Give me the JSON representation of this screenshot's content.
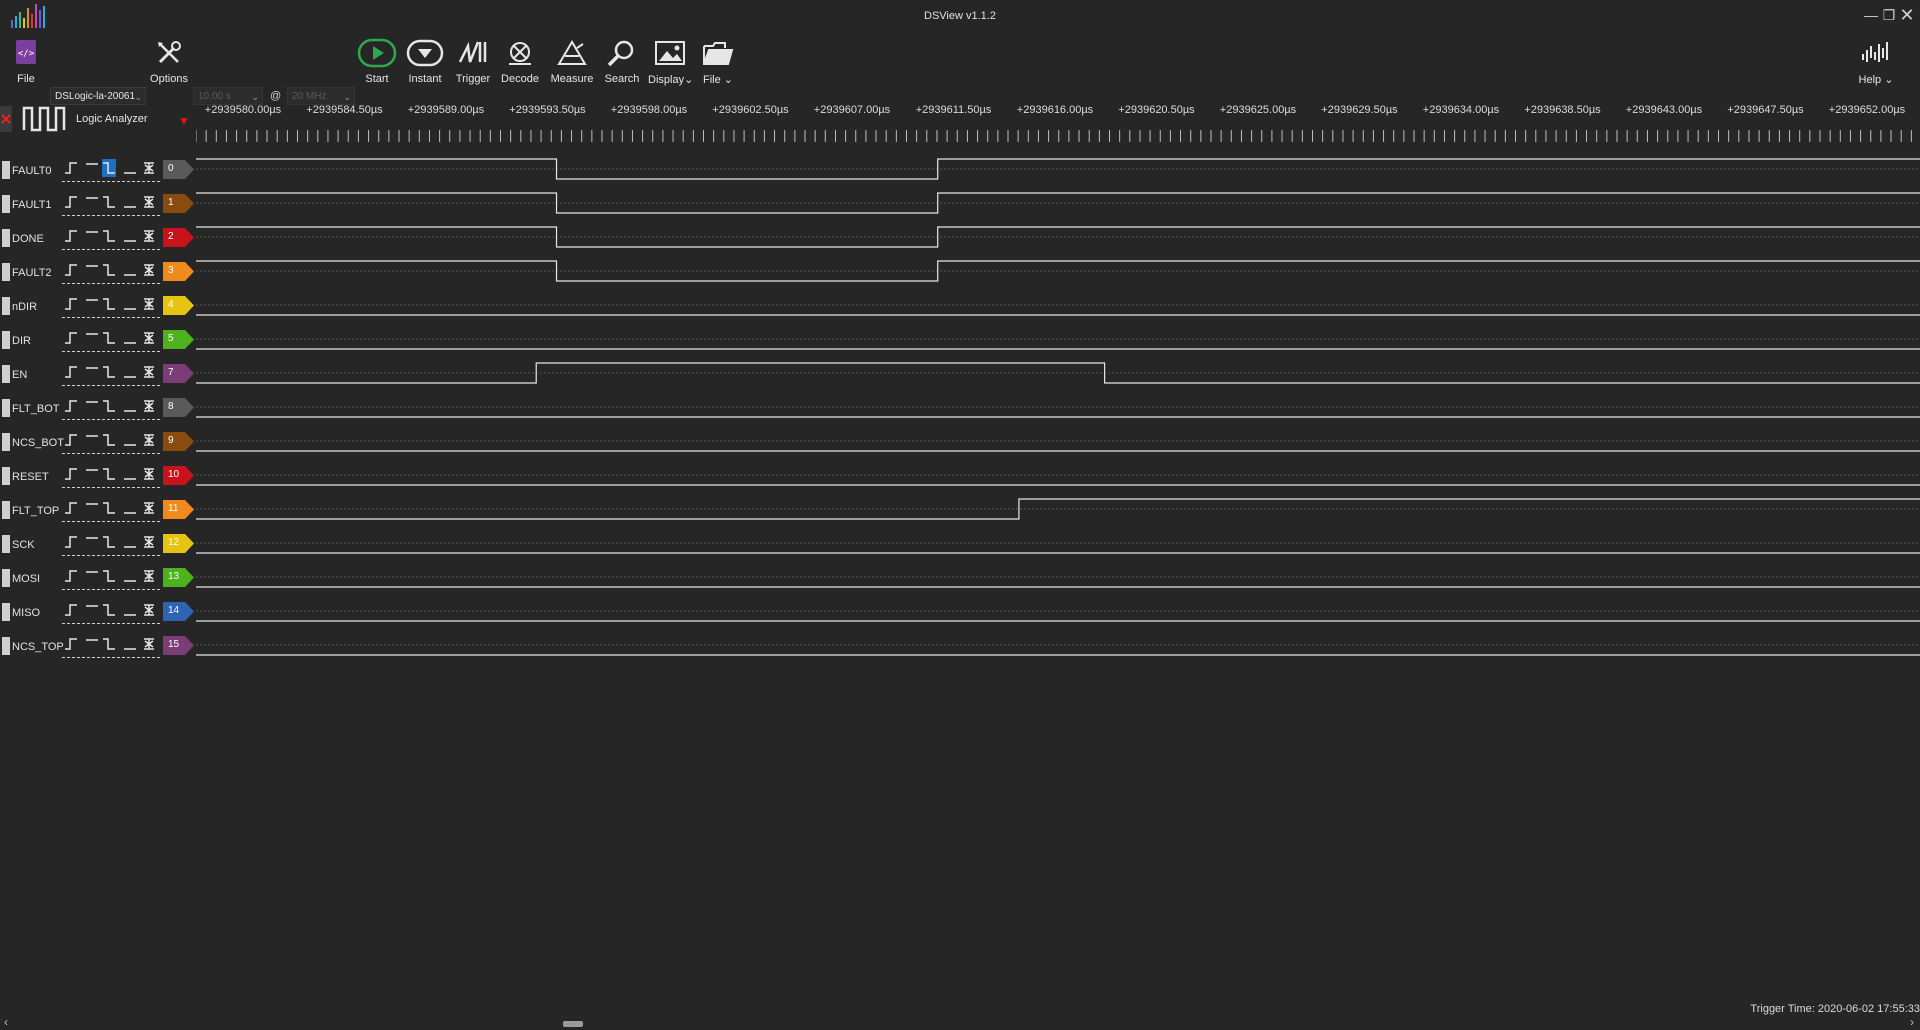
{
  "window": {
    "title": "DSView v1.1.2"
  },
  "toolbar": {
    "file_label": "File",
    "device_select": "DSLogic-la-20061",
    "options_label": "Options",
    "duration_select": "10.00 s",
    "at_sign": "@",
    "samplerate_select": "20 MHz",
    "start_label": "Start",
    "instant_label": "Instant",
    "trigger_label": "Trigger",
    "decode_label": "Decode",
    "measure_label": "Measure",
    "search_label": "Search",
    "display_label": "Display",
    "file_menu_label": "File",
    "help_label": "Help"
  },
  "device": {
    "mode_label": "Logic Analyzer"
  },
  "ruler": {
    "ticks": [
      "+2939580.00µs",
      "+2939584.50µs",
      "+2939589.00µs",
      "+2939593.50µs",
      "+2939598.00µs",
      "+2939602.50µs",
      "+2939607.00µs",
      "+2939611.50µs",
      "+2939616.00µs",
      "+2939620.50µs",
      "+2939625.00µs",
      "+2939629.50µs",
      "+2939634.00µs",
      "+2939638.50µs",
      "+2939643.00µs",
      "+2939647.50µs",
      "+2939652.00µs"
    ]
  },
  "channels": [
    {
      "name": "FAULT0",
      "index": "0",
      "color": "#5a5a5a",
      "selected_trigger": 2,
      "level": [
        1,
        0,
        1
      ],
      "edges_us": [
        2939593.9,
        2939610.8
      ]
    },
    {
      "name": "FAULT1",
      "index": "1",
      "color": "#8a4b0f",
      "selected_trigger": -1,
      "level": [
        1,
        0,
        1
      ],
      "edges_us": [
        2939593.9,
        2939610.8
      ]
    },
    {
      "name": "DONE",
      "index": "2",
      "color": "#c8131a",
      "selected_trigger": -1,
      "level": [
        1,
        0,
        1
      ],
      "edges_us": [
        2939593.9,
        2939610.8
      ]
    },
    {
      "name": "FAULT2",
      "index": "3",
      "color": "#f08a1d",
      "selected_trigger": -1,
      "level": [
        1,
        0,
        1
      ],
      "edges_us": [
        2939593.9,
        2939610.8
      ]
    },
    {
      "name": "nDIR",
      "index": "4",
      "color": "#e8c412",
      "selected_trigger": -1,
      "level": [
        0
      ],
      "edges_us": []
    },
    {
      "name": "DIR",
      "index": "5",
      "color": "#4db21e",
      "selected_trigger": -1,
      "level": [
        0
      ],
      "edges_us": []
    },
    {
      "name": "EN",
      "index": "7",
      "color": "#7a3d76",
      "selected_trigger": -1,
      "level": [
        0,
        1,
        0
      ],
      "edges_us": [
        2939593.0,
        2939618.2
      ]
    },
    {
      "name": "FLT_BOT",
      "index": "8",
      "color": "#5a5a5a",
      "selected_trigger": -1,
      "level": [
        0
      ],
      "edges_us": []
    },
    {
      "name": "NCS_BOT",
      "index": "9",
      "color": "#8a4b0f",
      "selected_trigger": -1,
      "level": [
        0
      ],
      "edges_us": []
    },
    {
      "name": "RESET",
      "index": "10",
      "color": "#c8131a",
      "selected_trigger": -1,
      "level": [
        0
      ],
      "edges_us": []
    },
    {
      "name": "FLT_TOP",
      "index": "11",
      "color": "#f08a1d",
      "selected_trigger": -1,
      "level": [
        0,
        1
      ],
      "edges_us": [
        2939614.4
      ]
    },
    {
      "name": "SCK",
      "index": "12",
      "color": "#e8c412",
      "selected_trigger": -1,
      "level": [
        0
      ],
      "edges_us": []
    },
    {
      "name": "MOSI",
      "index": "13",
      "color": "#4db21e",
      "selected_trigger": -1,
      "level": [
        0
      ],
      "edges_us": []
    },
    {
      "name": "MISO",
      "index": "14",
      "color": "#2f63b4",
      "selected_trigger": -1,
      "level": [
        0
      ],
      "edges_us": []
    },
    {
      "name": "NCS_TOP",
      "index": "15",
      "color": "#7a3d76",
      "selected_trigger": -1,
      "level": [
        0
      ],
      "edges_us": []
    }
  ],
  "status": {
    "trigger_time": "Trigger Time: 2020-06-02 17:55:33"
  }
}
